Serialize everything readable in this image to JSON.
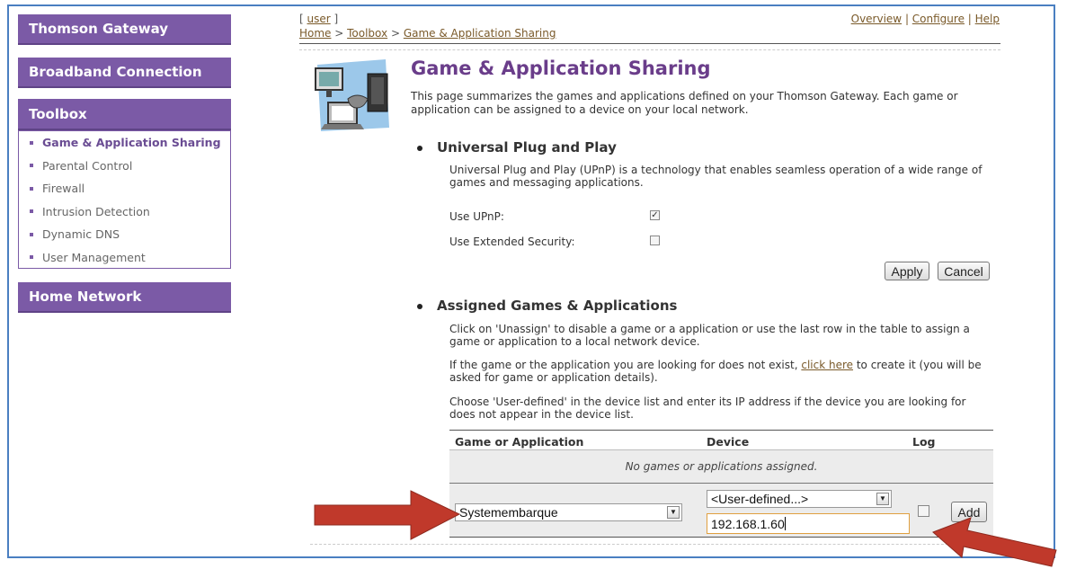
{
  "sidebar": {
    "gateway": "Thomson Gateway",
    "broadband": "Broadband Connection",
    "toolbox": "Toolbox",
    "toolbox_items": [
      "Game & Application Sharing",
      "Parental Control",
      "Firewall",
      "Intrusion Detection",
      "Dynamic DNS",
      "User Management"
    ],
    "home_network": "Home Network"
  },
  "header": {
    "user_open": "[ ",
    "user": "user",
    "user_close": " ]",
    "breadcrumb": [
      "Home",
      "Toolbox",
      "Game & Application Sharing"
    ],
    "breadcrumb_sep": " > ",
    "nav": [
      "Overview",
      "Configure",
      "Help"
    ],
    "nav_sep": " | "
  },
  "page": {
    "title": "Game & Application Sharing",
    "intro": "This page summarizes the games and applications defined on your Thomson Gateway. Each game or application can be assigned to a device on your local network."
  },
  "upnp": {
    "heading": "Universal Plug and Play",
    "description": "Universal Plug and Play (UPnP) is a technology that enables seamless operation of a wide range of games and messaging applications.",
    "use_upnp_label": "Use UPnP:",
    "use_upnp_checked": true,
    "use_upnp_mark": "✓",
    "ext_security_label": "Use Extended Security:",
    "ext_security_checked": false,
    "apply": "Apply",
    "cancel": "Cancel"
  },
  "assigned": {
    "heading": "Assigned Games & Applications",
    "para1": "Click on 'Unassign' to disable a game or a application or use the last row in the table to assign a game or application to a local network device.",
    "para2_before": "If the game or the application you are looking for does not exist, ",
    "para2_link": "click here",
    "para2_after": " to create it (you will be asked for game or application details).",
    "para3": "Choose 'User-defined' in the device list and enter its IP address if the device you are looking for does not appear in the device list.",
    "table": {
      "columns": [
        "Game or Application",
        "Device",
        "Log"
      ],
      "empty_message": "No games or applications assigned.",
      "new_row": {
        "application_value": "Systemembarque",
        "device_value": "<User-defined...>",
        "ip_value": "192.168.1.60",
        "log_checked": false,
        "add": "Add"
      }
    }
  },
  "annotations": {
    "arrow_color": "#c0392b"
  }
}
